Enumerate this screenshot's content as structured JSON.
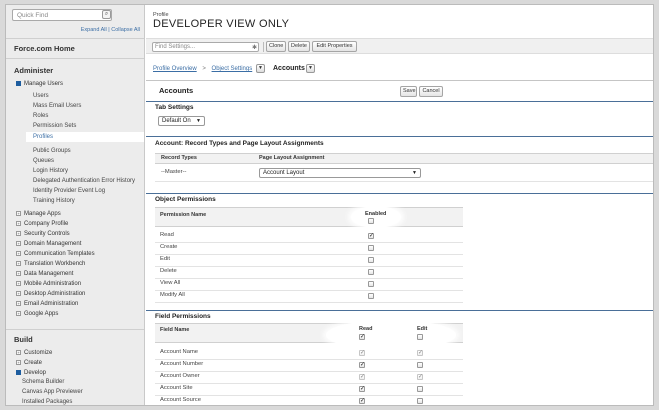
{
  "sidebar": {
    "quick_find_placeholder": "Quick Find",
    "expand_all": "Expand All",
    "collapse_all": "Collapse All",
    "link_separator": "|",
    "home_label": "Force.com Home",
    "administer_heading": "Administer",
    "manage_users_label": "Manage Users",
    "manage_users_sub": [
      "Users",
      "Mass Email Users",
      "Roles",
      "Permission Sets",
      "Profiles",
      "Public Groups",
      "Queues",
      "Login History",
      "Delegated Authentication Error History",
      "Identity Provider Event Log",
      "Training History"
    ],
    "admin_sections": [
      "Manage Apps",
      "Company Profile",
      "Security Controls",
      "Domain Management",
      "Communication Templates",
      "Translation Workbench",
      "Data Management",
      "Mobile Administration",
      "Desktop Administration",
      "Email Administration",
      "Google Apps"
    ],
    "build_heading": "Build",
    "build_items": [
      "Customize",
      "Create",
      "Develop"
    ],
    "develop_sub": [
      "Schema Builder",
      "Canvas App Previewer",
      "Installed Packages"
    ]
  },
  "header": {
    "crumb_type": "Profile",
    "title": "DEVELOPER VIEW ONLY"
  },
  "toolbar": {
    "find_placeholder": "Find Settings...",
    "clone_label": "Clone",
    "delete_label": "Delete",
    "edit_properties_label": "Edit Properties"
  },
  "nav": {
    "overview_link": "Profile Overview",
    "separator": ">",
    "object_settings_link": "Object Settings",
    "current": "Accounts"
  },
  "object": {
    "title": "Accounts",
    "save_label": "Save",
    "cancel_label": "Cancel"
  },
  "tab_settings": {
    "title": "Tab Settings",
    "value": "Default On"
  },
  "record_types": {
    "title": "Account: Record Types and Page Layout Assignments",
    "col_record_types": "Record Types",
    "col_page_layout": "Page Layout Assignment",
    "rows": [
      {
        "record_type": "--Master--",
        "layout": "Account Layout"
      }
    ]
  },
  "object_permissions": {
    "title": "Object Permissions",
    "col_name": "Permission Name",
    "col_enabled": "Enabled",
    "rows": [
      {
        "name": "Read",
        "checked": true
      },
      {
        "name": "Create",
        "checked": false
      },
      {
        "name": "Edit",
        "checked": false
      },
      {
        "name": "Delete",
        "checked": false
      },
      {
        "name": "View All",
        "checked": false
      },
      {
        "name": "Modify All",
        "checked": false
      }
    ]
  },
  "field_permissions": {
    "title": "Field Permissions",
    "col_name": "Field Name",
    "col_read": "Read",
    "col_edit": "Edit",
    "rows": [
      {
        "name": "Account Name",
        "read": true,
        "edit": true,
        "read_disabled": true,
        "edit_disabled": true
      },
      {
        "name": "Account Number",
        "read": true,
        "edit": false,
        "read_disabled": false,
        "edit_disabled": false
      },
      {
        "name": "Account Owner",
        "read": true,
        "edit": true,
        "read_disabled": true,
        "edit_disabled": true
      },
      {
        "name": "Account Site",
        "read": true,
        "edit": false,
        "read_disabled": false,
        "edit_disabled": false
      },
      {
        "name": "Account Source",
        "read": true,
        "edit": false,
        "read_disabled": false,
        "edit_disabled": false
      }
    ]
  },
  "colors": {
    "link": "#3b6ea5",
    "section_rule": "#4a6f98",
    "sidebar_bg": "#ececec"
  },
  "icons": {
    "search": "search-icon",
    "clear": "clear-icon",
    "dropdown": "chevron-down-icon",
    "expand": "plus-icon",
    "collapse": "minus-icon",
    "check": "checkmark-icon"
  }
}
